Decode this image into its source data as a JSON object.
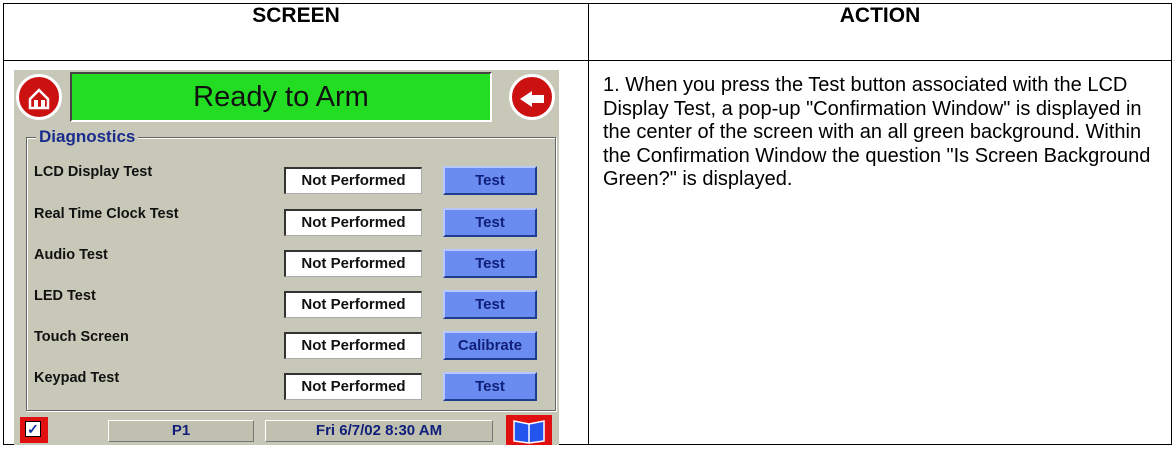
{
  "table": {
    "header_screen": "SCREEN",
    "header_action": "ACTION"
  },
  "device": {
    "status": "Ready to Arm",
    "group_title": "Diagnostics",
    "tests": [
      {
        "label": "LCD Display Test",
        "result": "Not Performed",
        "button": "Test"
      },
      {
        "label": "Real Time Clock Test",
        "result": "Not Performed",
        "button": "Test"
      },
      {
        "label": "Audio Test",
        "result": "Not Performed",
        "button": "Test"
      },
      {
        "label": "LED Test",
        "result": "Not Performed",
        "button": "Test"
      },
      {
        "label": "Touch Screen",
        "result": "Not Performed",
        "button": "Calibrate"
      },
      {
        "label": "Keypad Test",
        "result": "Not Performed",
        "button": "Test"
      }
    ],
    "page": "P1",
    "datetime": "Fri 6/7/02  8:30 AM",
    "icons": {
      "home": "home-icon",
      "back": "back-arrow-icon",
      "check": "checkbox-icon",
      "book": "book-icon"
    },
    "colors": {
      "status_banner": "#22dd22",
      "panel": "#c8c8b8",
      "button": "#6a8cf0",
      "accent_red": "#cc1111"
    }
  },
  "action_text": "1. When you press the Test button associated with the LCD Display Test, a pop-up \"Confirmation Window\" is displayed in the center of the screen with an all green background. Within the Confirmation Window the question \"Is Screen Background Green?\" is displayed."
}
